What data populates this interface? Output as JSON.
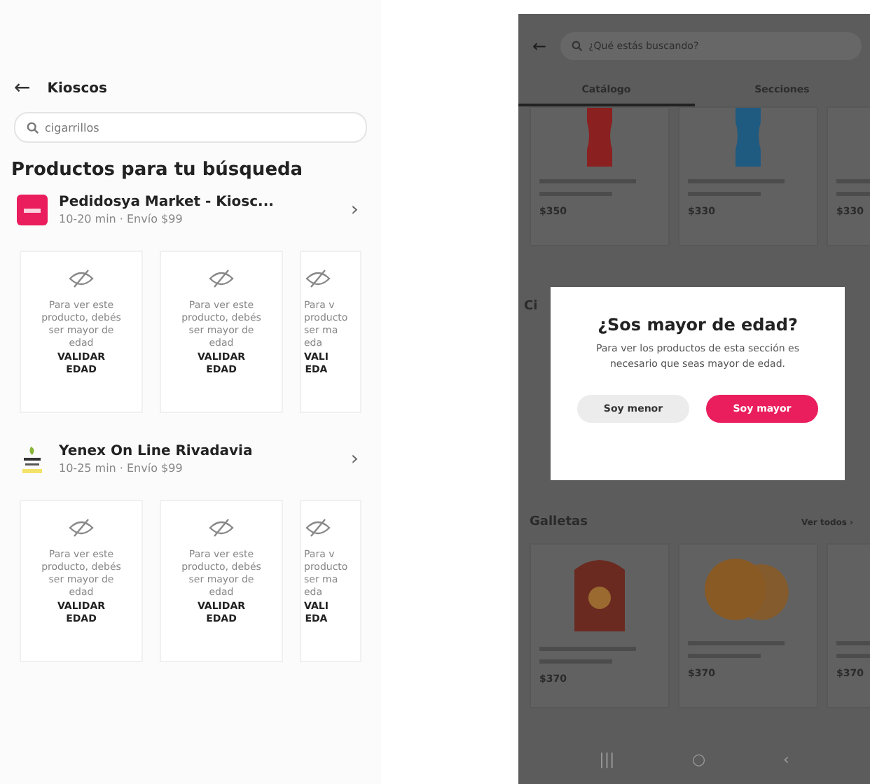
{
  "left_screen": {
    "header": {
      "back": "←",
      "title": "Kioscos"
    },
    "search": {
      "value": "cigarrillos"
    },
    "heading": "Productos para tu búsqueda",
    "stores": [
      {
        "name": "Pedidosya Market - Kiosc...",
        "meta": "10-20 min · Envío $99",
        "kind": "badge",
        "chevron": "›",
        "cards": [
          {
            "lines": [
              "Para ver este",
              "producto, debés",
              "ser mayor de",
              "edad"
            ],
            "action": [
              "VALIDAR",
              "EDAD"
            ]
          },
          {
            "lines": [
              "Para ver este",
              "producto, debés",
              "ser mayor de",
              "edad"
            ],
            "action": [
              "VALIDAR",
              "EDAD"
            ]
          },
          {
            "lines": [
              "Para v",
              "producto",
              "ser ma",
              "eda"
            ],
            "action": [
              "VALI",
              "EDA"
            ]
          }
        ]
      },
      {
        "name": "Yenex On Line Rivadavia",
        "meta": "10-25 min · Envío $99",
        "kind": "leaf",
        "chevron": "›",
        "cards": [
          {
            "lines": [
              "Para ver este",
              "producto, debés",
              "ser mayor de",
              "edad"
            ],
            "action": [
              "VALIDAR",
              "EDAD"
            ]
          },
          {
            "lines": [
              "Para ver este",
              "producto, debés",
              "ser mayor de",
              "edad"
            ],
            "action": [
              "VALIDAR",
              "EDAD"
            ]
          },
          {
            "lines": [
              "Para v",
              "producto",
              "ser ma",
              "eda"
            ],
            "action": [
              "VALI",
              "EDA"
            ]
          }
        ]
      }
    ]
  },
  "right_screen": {
    "back": "←",
    "search": {
      "placeholder": "¿Qué estás buscando?"
    },
    "tabs": [
      {
        "label": "Catálogo",
        "selected": true
      },
      {
        "label": "Secciones",
        "selected": false
      }
    ],
    "top_products": [
      {
        "price": "$350",
        "kind": "bottle",
        "color": "#8a2020"
      },
      {
        "price": "$330",
        "kind": "bottle",
        "color": "#1f5a80"
      },
      {
        "price": "$330",
        "kind": "none"
      }
    ],
    "hidden_section": {
      "title": "Ci"
    },
    "section": {
      "title": "Galletas",
      "link": "Ver todos ›"
    },
    "products": [
      {
        "price": "$370",
        "kind": "package",
        "color": "#6b2a20"
      },
      {
        "price": "$370",
        "kind": "cookie",
        "color": "#8a5a25"
      },
      {
        "price": "$370",
        "kind": "none"
      }
    ],
    "modal": {
      "title": "¿Sos mayor de edad?",
      "text": "Para ver los productos de esta sección es necesario que seas mayor de edad.",
      "buttons": [
        {
          "label": "Soy menor",
          "kind": "secondary"
        },
        {
          "label": "Soy mayor",
          "kind": "primary"
        }
      ]
    },
    "nav": [
      "|||",
      "○",
      "‹"
    ]
  }
}
